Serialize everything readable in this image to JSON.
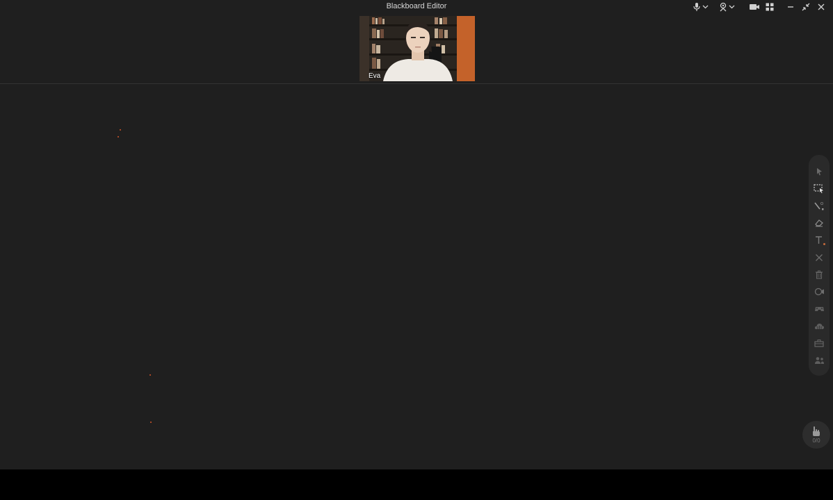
{
  "window": {
    "title": "Blackboard Editor"
  },
  "title_controls": [
    {
      "name": "microphone-dropdown",
      "icon": "microphone-icon"
    },
    {
      "name": "speaker-dropdown",
      "icon": "speaker-icon"
    },
    {
      "name": "camera-button",
      "icon": "camera-icon"
    },
    {
      "name": "layout-button",
      "icon": "grid-layout-icon"
    },
    {
      "name": "minimize-button",
      "icon": "minimize-icon"
    },
    {
      "name": "restore-button",
      "icon": "shrink-icon"
    },
    {
      "name": "close-button",
      "icon": "close-icon"
    }
  ],
  "video": {
    "participant_name": "Eva"
  },
  "tools": [
    {
      "name": "select-tool",
      "icon": "cursor-icon"
    },
    {
      "name": "area-select-tool",
      "icon": "marquee-select-icon"
    },
    {
      "name": "pen-tool",
      "icon": "pen-icon"
    },
    {
      "name": "eraser-tool",
      "icon": "eraser-icon"
    },
    {
      "name": "text-tool",
      "icon": "text-icon"
    },
    {
      "name": "clear-tool",
      "icon": "x-icon"
    },
    {
      "name": "delete-tool",
      "icon": "trash-icon"
    },
    {
      "name": "record-tool",
      "icon": "video-record-icon"
    },
    {
      "name": "responder-tool",
      "icon": "game-controller-icon"
    },
    {
      "name": "cloud-tool",
      "icon": "cloud-icon"
    },
    {
      "name": "toolbox-tool",
      "icon": "toolbox-icon"
    },
    {
      "name": "users-tool",
      "icon": "users-icon"
    }
  ],
  "hand_raise": {
    "count_label": "0/0",
    "icon": "raise-hand-icon"
  },
  "colors": {
    "background": "#1f1f1f",
    "accent": "#d2562a"
  }
}
